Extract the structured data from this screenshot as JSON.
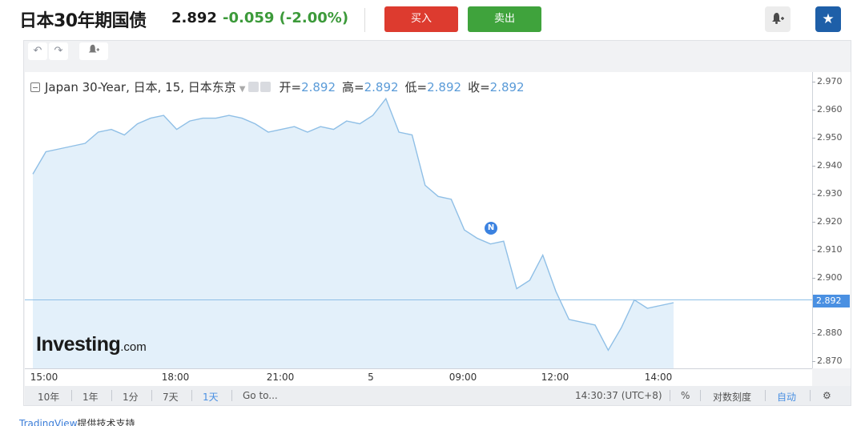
{
  "header": {
    "title": "日本30年期国债",
    "price": "2.892",
    "change": "-0.059 (-2.00%)",
    "buy_label": "买入",
    "sell_label": "卖出",
    "alert_icon": "bell-plus-icon",
    "star_icon": "star-icon",
    "colors": {
      "buy": "#dd3b2f",
      "sell": "#3fa33c",
      "change": "#3c9a3a",
      "star_bg": "#1e5fa8"
    }
  },
  "toolbar": {
    "undo_icon": "undo-icon",
    "redo_icon": "redo-icon",
    "alert_icon": "bell-plus-icon"
  },
  "legend": {
    "symbol": "Japan 30-Year, 日本, 15, 日本东京",
    "open_label": "开=",
    "open": "2.892",
    "high_label": "高=",
    "high": "2.892",
    "low_label": "低=",
    "low": "2.892",
    "close_label": "收=",
    "close": "2.892"
  },
  "watermark": {
    "brand": "Investing",
    "suffix": ".com"
  },
  "news_marker": "N",
  "chart_data": {
    "type": "area",
    "title": "",
    "xlabel": "",
    "ylabel": "",
    "x_tick_labels": [
      "15:00",
      "18:00",
      "21:00",
      "5",
      "09:00",
      "12:00",
      "14:00"
    ],
    "y_tick_labels": [
      "2.970",
      "2.960",
      "2.950",
      "2.940",
      "2.930",
      "2.920",
      "2.910",
      "2.900",
      "2.880",
      "2.870"
    ],
    "ylim": [
      2.8675,
      2.9735
    ],
    "last_value_label": "2.892",
    "grid": false,
    "series": [
      {
        "values": [
          2.937,
          2.945,
          2.946,
          2.947,
          2.948,
          2.952,
          2.953,
          2.951,
          2.955,
          2.957,
          2.958,
          2.953,
          2.956,
          2.957,
          2.957,
          2.958,
          2.957,
          2.955,
          2.952,
          2.953,
          2.954,
          2.952,
          2.954,
          2.953,
          2.956,
          2.955,
          2.958,
          2.964,
          2.952,
          2.951,
          2.933,
          2.929,
          2.928,
          2.917,
          2.914,
          2.912,
          2.913,
          2.896,
          2.899,
          2.908,
          2.895,
          2.885,
          2.884,
          2.883,
          2.874,
          2.882,
          2.892,
          2.889,
          2.89,
          2.891
        ]
      }
    ],
    "colors": {
      "line": "#8fbfe6",
      "fill": "#e3f0fa",
      "last_price_bg": "#4a90e2"
    }
  },
  "bottombar": {
    "ranges": [
      "10年",
      "1年",
      "1分",
      "7天",
      "1天",
      "Go to..."
    ],
    "active_range": "1天",
    "time": "14:30:37 (UTC+8)",
    "percent": "%",
    "log_scale": "对数刻度",
    "auto": "自动",
    "settings_icon": "gear-icon"
  },
  "credit": {
    "link": "TradingView",
    "text": "提供技术支持"
  }
}
